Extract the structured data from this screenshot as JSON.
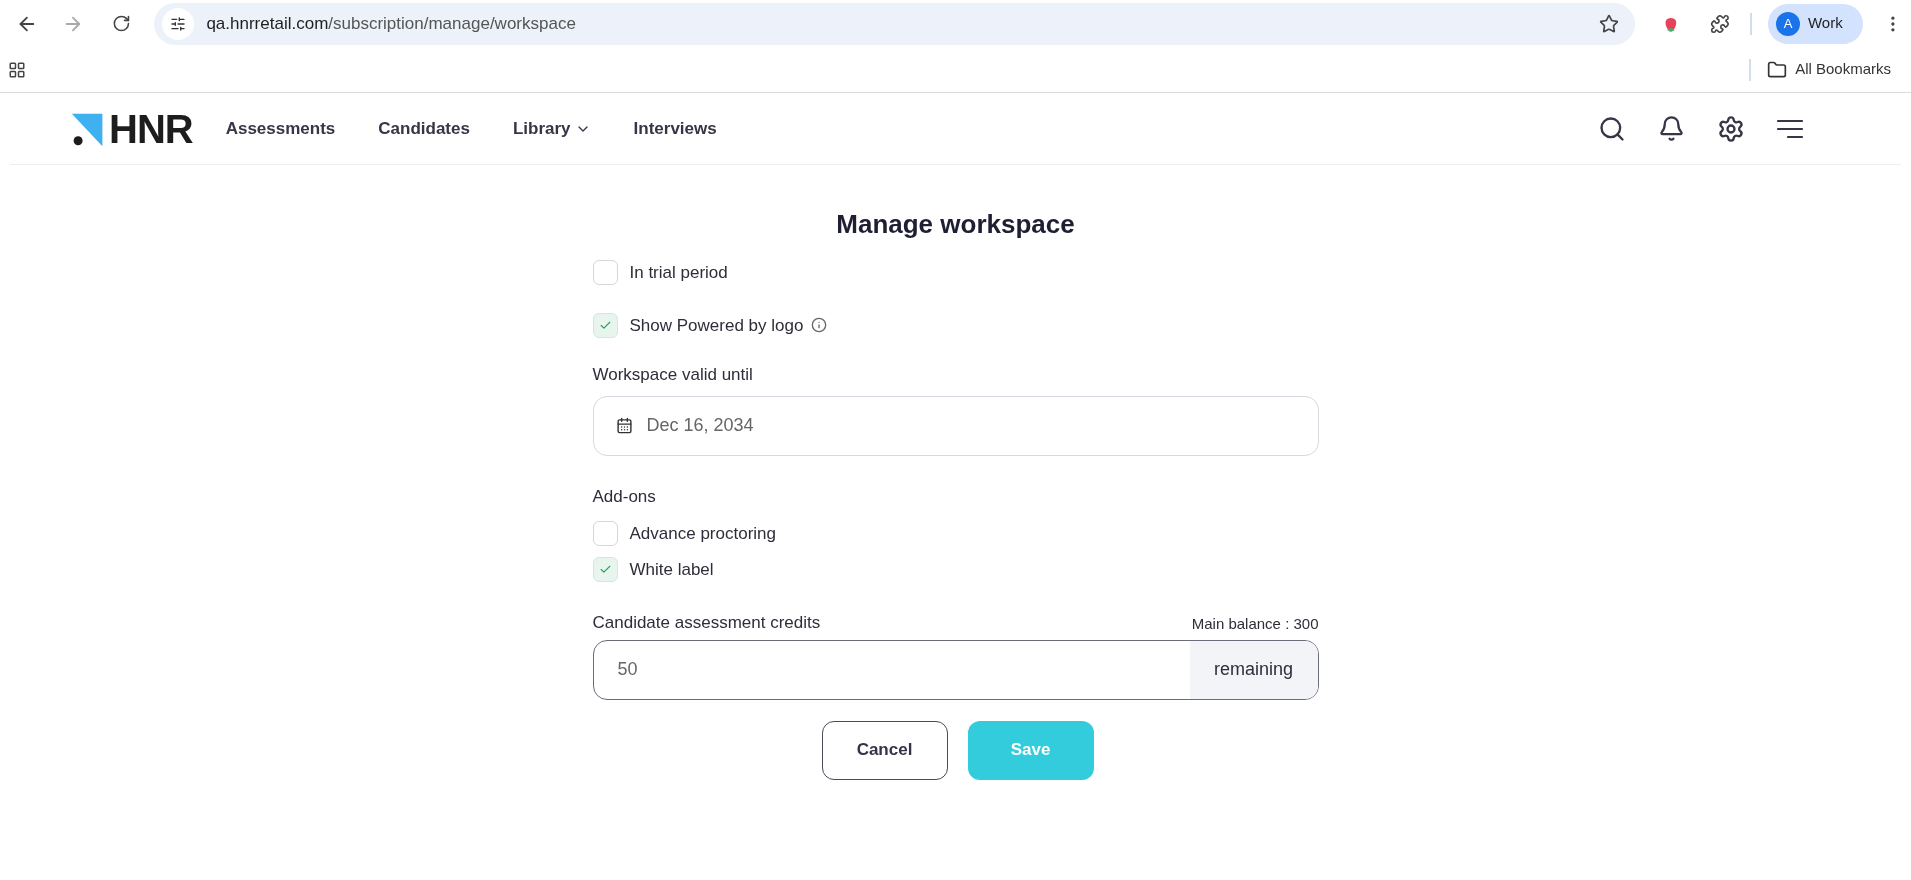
{
  "browser": {
    "url_host": "qa.hnrretail.com",
    "url_path": "/subscription/manage/workspace",
    "profile_initial": "A",
    "profile_name": "Work",
    "bookmarks_label": "All Bookmarks"
  },
  "nav": {
    "logo": "HNR",
    "items": [
      {
        "label": "Assessments",
        "dropdown": false
      },
      {
        "label": "Candidates",
        "dropdown": false
      },
      {
        "label": "Library",
        "dropdown": true
      },
      {
        "label": "Interviews",
        "dropdown": false
      }
    ]
  },
  "form": {
    "title": "Manage workspace",
    "options": [
      {
        "label": "In trial period",
        "checked": false,
        "info": false
      },
      {
        "label": "Show Powered by logo",
        "checked": true,
        "info": true
      }
    ],
    "valid_until": {
      "label": "Workspace valid until",
      "value": "Dec 16, 2034"
    },
    "addons": {
      "label": "Add-ons",
      "items": [
        {
          "label": "Advance proctoring",
          "checked": false
        },
        {
          "label": "White label",
          "checked": true
        }
      ]
    },
    "credits": {
      "label": "Candidate assessment credits",
      "balance": "Main balance : 300",
      "value": "50",
      "suffix": "remaining"
    },
    "buttons": [
      {
        "label": "Cancel",
        "kind": "secondary"
      },
      {
        "label": "Save",
        "kind": "primary"
      }
    ]
  }
}
